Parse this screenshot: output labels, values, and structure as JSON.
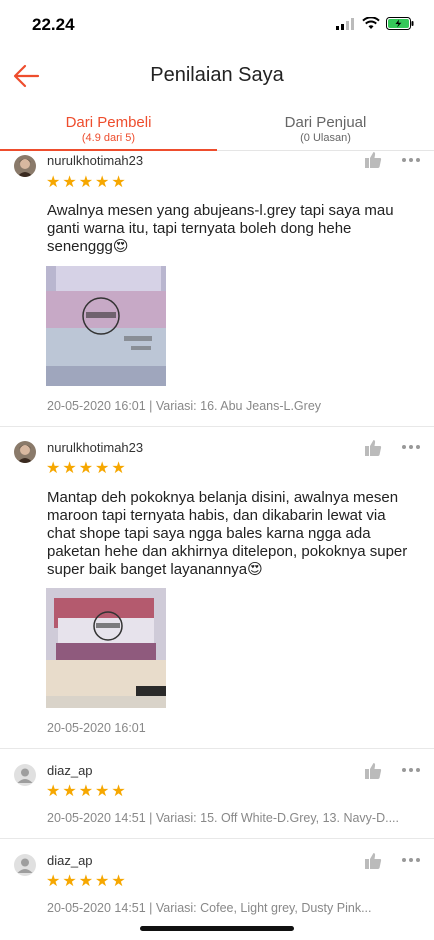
{
  "status": {
    "time": "22.24"
  },
  "header": {
    "title": "Penilaian Saya"
  },
  "tabs": [
    {
      "label": "Dari Pembeli",
      "sub": "(4.9 dari 5)"
    },
    {
      "label": "Dari Penjual",
      "sub": "(0 Ulasan)"
    }
  ],
  "reviews": [
    {
      "username": "nurulkhotimah23",
      "stars": 5,
      "text": "Awalnya mesen yang abujeans-l.grey tapi saya mau ganti warna itu, tapi ternyata boleh dong hehe senenggg😍",
      "meta": "20-05-2020 16:01 | Variasi: 16. Abu Jeans-L.Grey"
    },
    {
      "username": "nurulkhotimah23",
      "stars": 5,
      "text": "Mantap deh pokoknya belanja disini, awalnya mesen maroon tapi ternyata habis, dan dikabarin lewat via chat shope tapi saya ngga bales karna ngga ada paketan hehe dan akhirnya ditelepon, pokoknya super super baik banget layanannya😍",
      "meta": "20-05-2020 16:01"
    },
    {
      "username": "diaz_ap",
      "stars": 5,
      "meta": "20-05-2020 14:51 | Variasi: 15. Off White-D.Grey, 13. Navy-D...."
    },
    {
      "username": "diaz_ap",
      "stars": 5,
      "meta": "20-05-2020 14:51 | Variasi: Cofee, Light grey, Dusty Pink..."
    }
  ],
  "icons": {
    "back": "arrow-left-icon",
    "like": "thumbs-up-icon",
    "more": "more-dots-icon"
  },
  "colors": {
    "accent": "#ee4d2d",
    "star": "#f6a700"
  }
}
